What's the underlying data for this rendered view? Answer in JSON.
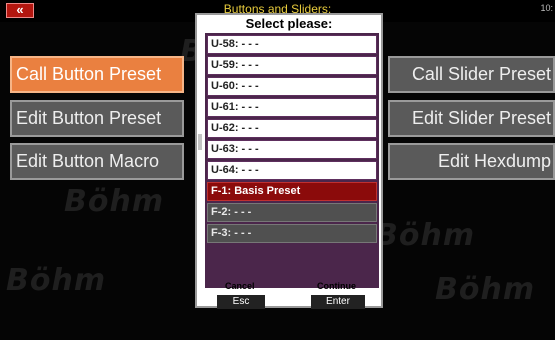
{
  "header": {
    "back_icon": "double-chevron-left",
    "title": "Buttons and Sliders:",
    "clock": "10:"
  },
  "watermark_text": "Böhm",
  "menu": {
    "left": [
      "Call Button Preset",
      "Edit Button Preset",
      "Edit Button Macro"
    ],
    "right": [
      "Call Slider Preset",
      "Edit Slider Preset",
      "Edit Hexdump"
    ]
  },
  "dialog": {
    "title": "Select please:",
    "items": [
      {
        "label": "U-58: - - -",
        "state": "normal"
      },
      {
        "label": "U-59: - - -",
        "state": "normal"
      },
      {
        "label": "U-60: - - -",
        "state": "normal"
      },
      {
        "label": "U-61: - - -",
        "state": "normal"
      },
      {
        "label": "U-62: - - -",
        "state": "normal"
      },
      {
        "label": "U-63: - - -",
        "state": "normal"
      },
      {
        "label": "U-64: - - -",
        "state": "normal"
      },
      {
        "label": "F-1: Basis Preset",
        "state": "selected"
      },
      {
        "label": "F-2: - - -",
        "state": "dim"
      },
      {
        "label": "F-3: - - -",
        "state": "dim"
      }
    ],
    "cancel_label": "Cancel",
    "cancel_button": "Esc",
    "continue_label": "Continue",
    "continue_button": "Enter"
  },
  "colors": {
    "active_button": "#ea8040",
    "title_yellow": "#e8cc3d",
    "selected_item": "#8b0b0b"
  }
}
